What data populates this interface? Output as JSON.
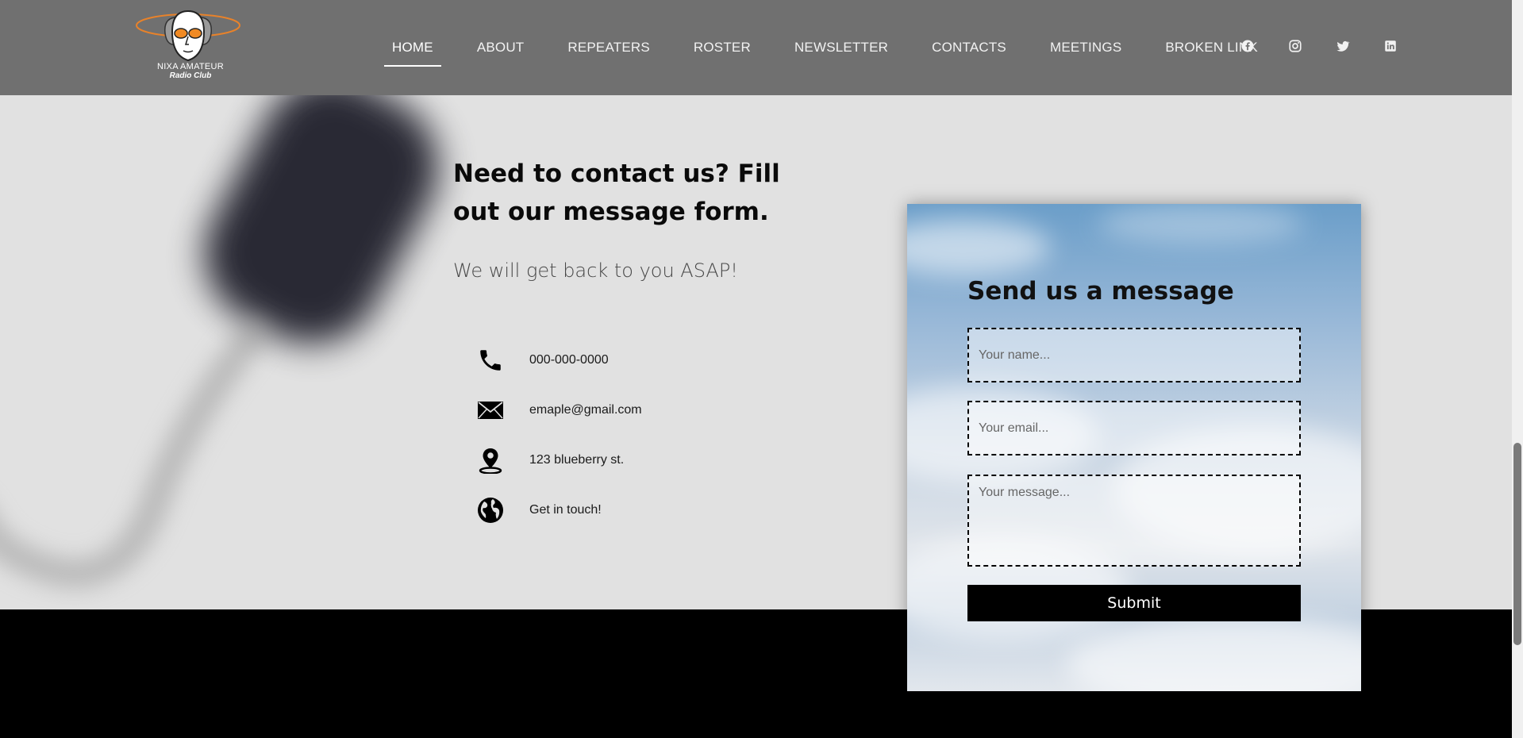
{
  "logo": {
    "line1": "NIXA AMATEUR",
    "line2": "Radio Club"
  },
  "nav": {
    "items": [
      {
        "label": "HOME",
        "active": true
      },
      {
        "label": "ABOUT"
      },
      {
        "label": "REPEATERS"
      },
      {
        "label": "ROSTER"
      },
      {
        "label": "NEWSLETTER"
      },
      {
        "label": "CONTACTS"
      },
      {
        "label": "MEETINGS"
      },
      {
        "label": "BROKEN LINK"
      }
    ]
  },
  "social": [
    "facebook-icon",
    "instagram-icon",
    "twitter-icon",
    "linkedin-icon"
  ],
  "intro": {
    "heading": "Need to contact us? Fill out our message form.",
    "subheading": "We will get back to you ASAP!"
  },
  "contact": {
    "phone": "000-000-0000",
    "email": "emaple@gmail.com",
    "address": "123 blueberry st.",
    "web": "Get in touch!"
  },
  "form": {
    "title": "Send us a message",
    "name_placeholder": "Your name...",
    "email_placeholder": "Your email...",
    "message_placeholder": "Your message...",
    "submit_label": "Submit"
  },
  "colors": {
    "header_bg": "#707070",
    "main_bg": "#e1e1e1",
    "footer_bg": "#000000",
    "logo_accent": "#e8822a"
  }
}
